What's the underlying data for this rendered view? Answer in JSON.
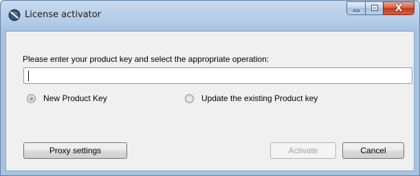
{
  "window": {
    "title": "License activator",
    "icon": "app-logo-icon"
  },
  "titlebar_buttons": {
    "minimize": "minimize-icon",
    "maximize": "maximize-icon",
    "close": "close-icon",
    "close_glyph": "X"
  },
  "form": {
    "prompt": "Please enter your product key and select the appropriate operation:",
    "product_key_value": "",
    "options": [
      {
        "label": "New Product Key",
        "selected": true
      },
      {
        "label": "Update the existing Product key",
        "selected": false
      }
    ]
  },
  "buttons": {
    "proxy": "Proxy settings",
    "activate": "Activate",
    "cancel": "Cancel"
  },
  "colors": {
    "titlebar": "#b5cde7",
    "close_button": "#c2391c",
    "radio_selected": "#1b63b3"
  }
}
